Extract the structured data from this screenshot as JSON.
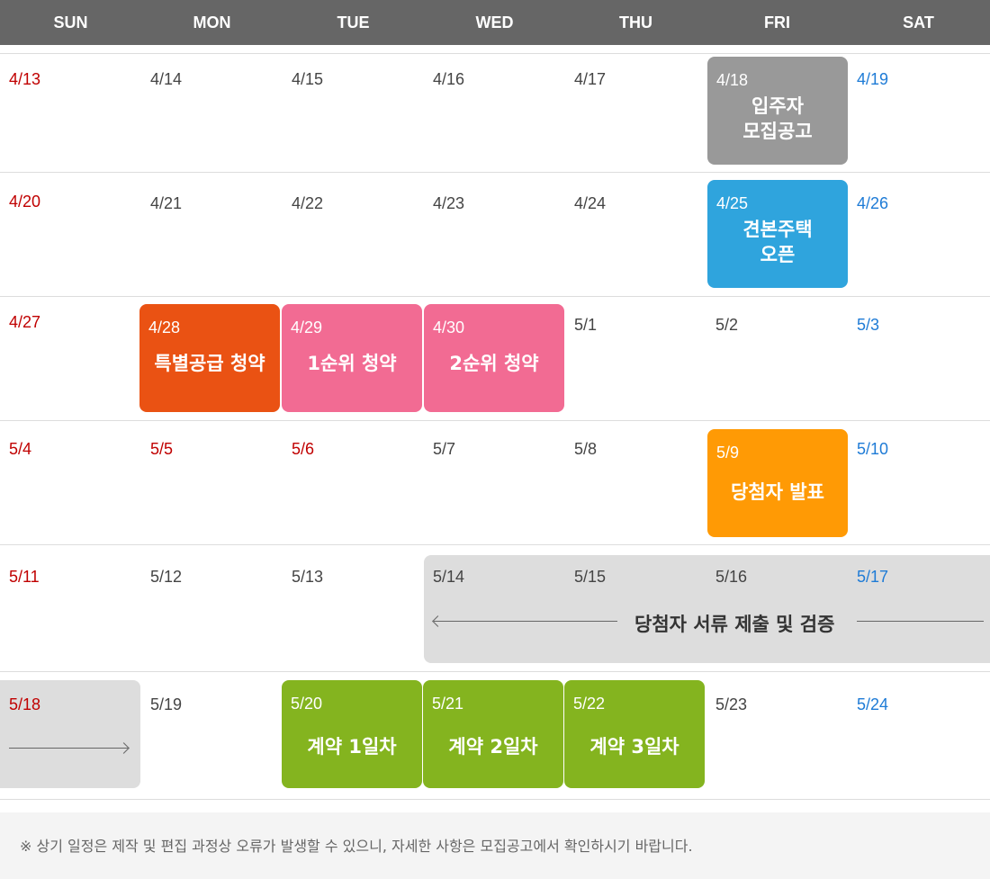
{
  "weekdays": [
    "SUN",
    "MON",
    "TUE",
    "WED",
    "THU",
    "FRI",
    "SAT"
  ],
  "weeks": [
    [
      "4/13",
      "4/14",
      "4/15",
      "4/16",
      "4/17",
      "4/18",
      "4/19"
    ],
    [
      "4/20",
      "4/21",
      "4/22",
      "4/23",
      "4/24",
      "4/25",
      "4/26"
    ],
    [
      "4/27",
      "4/28",
      "4/29",
      "4/30",
      "5/1",
      "5/2",
      "5/3"
    ],
    [
      "5/4",
      "5/5",
      "5/6",
      "5/7",
      "5/8",
      "5/9",
      "5/10"
    ],
    [
      "5/11",
      "5/12",
      "5/13",
      "5/14",
      "5/15",
      "5/16",
      "5/17"
    ],
    [
      "5/18",
      "5/19",
      "5/20",
      "5/21",
      "5/22",
      "5/23",
      "5/24"
    ]
  ],
  "events": {
    "notice_posting": {
      "date": "4/18",
      "title": "입주자\n모집공고",
      "color": "#999999"
    },
    "model_house": {
      "date": "4/25",
      "title": "견본주택\n오픈",
      "color": "#2fa4dd"
    },
    "special_supply": {
      "date": "4/28",
      "title": "특별공급 청약",
      "color": "#ea5213"
    },
    "first_priority": {
      "date": "4/29",
      "title": "1순위 청약",
      "color": "#f26b93"
    },
    "second_priority": {
      "date": "4/30",
      "title": "2순위 청약",
      "color": "#f26b93"
    },
    "winner_announcement": {
      "date": "5/9",
      "title": "당첨자 발표",
      "color": "#ff9a05"
    },
    "document_submission": {
      "title": "당첨자 서류 제출 및 검증",
      "color": "#dddddd"
    },
    "contract_day1": {
      "date": "5/20",
      "title": "계약 1일차",
      "color": "#84b41f"
    },
    "contract_day2": {
      "date": "5/21",
      "title": "계약 2일차",
      "color": "#84b41f"
    },
    "contract_day3": {
      "date": "5/22",
      "title": "계약 3일차",
      "color": "#84b41f"
    }
  },
  "notice": "※ 상기 일정은 제작 및 편집 과정상 오류가 발생할 수 있으니, 자세한 사항은 모집공고에서 확인하시기 바랍니다.",
  "colors": {
    "sunday": "#c00000",
    "saturday": "#1e7bd6",
    "header_bg": "#666666"
  }
}
